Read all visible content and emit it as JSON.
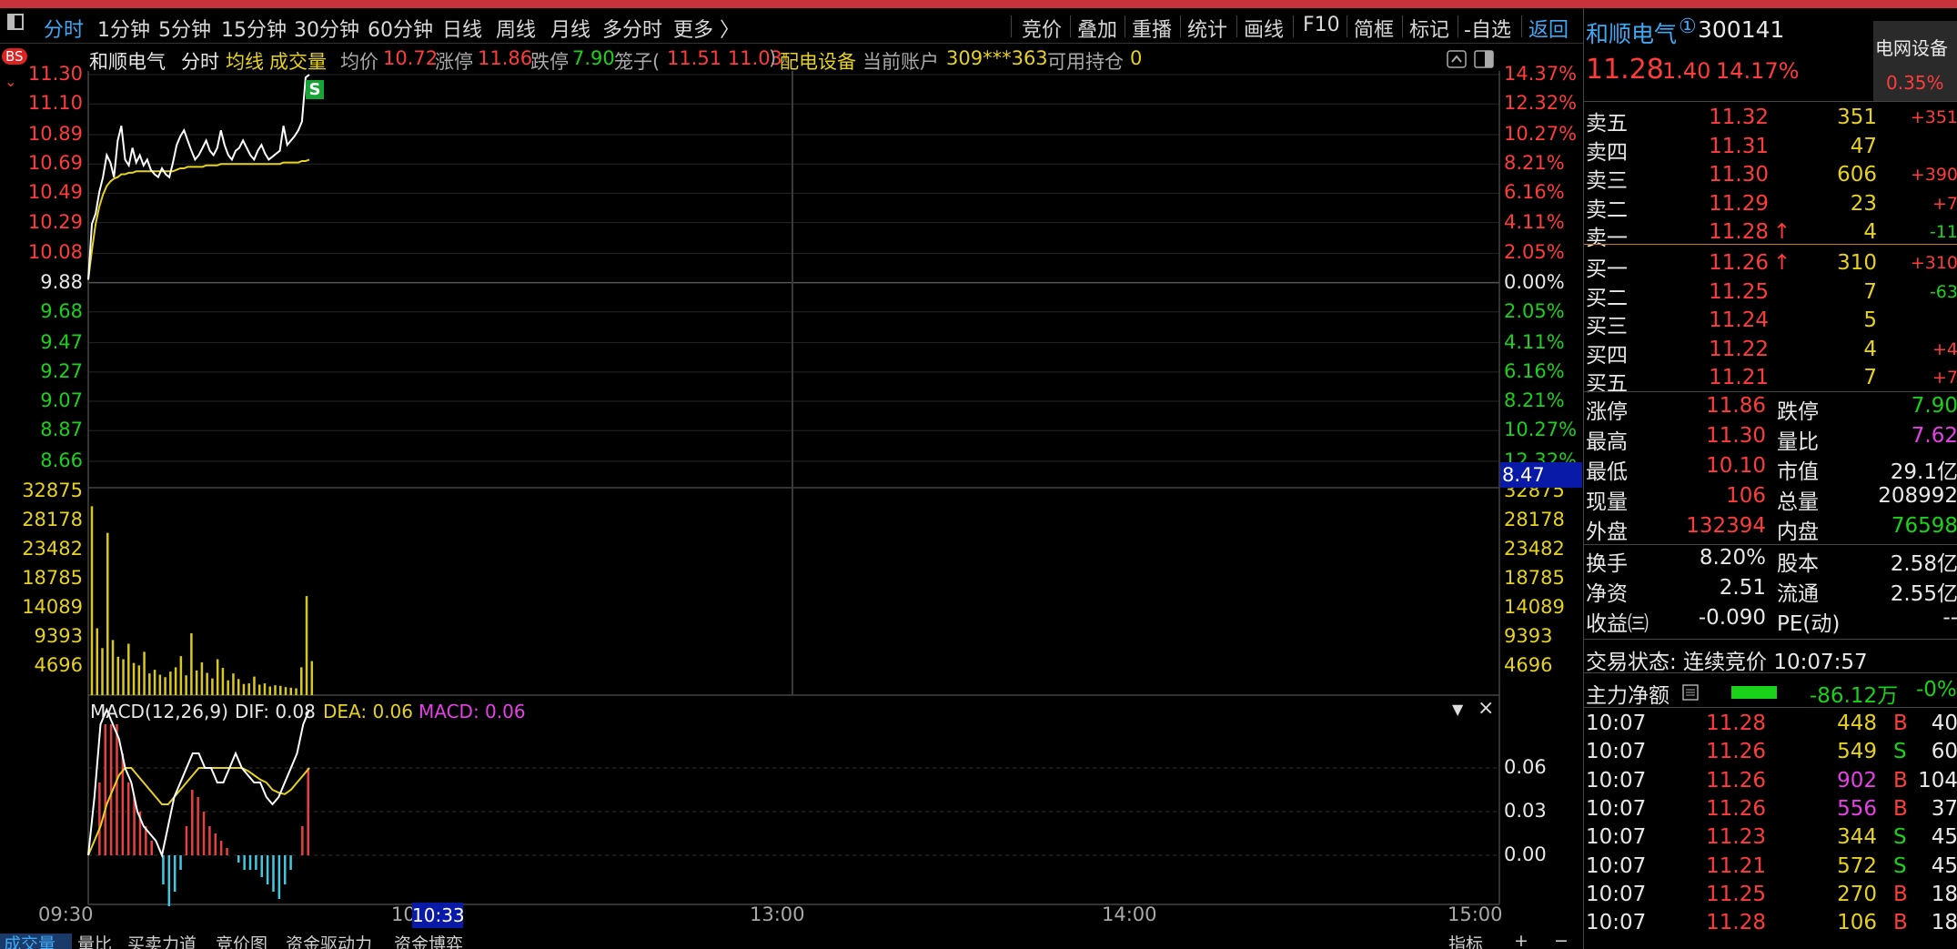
{
  "toolbar": {
    "left_tabs": [
      "分时",
      "1分钟",
      "5分钟",
      "15分钟",
      "30分钟",
      "60分钟",
      "日线",
      "周线",
      "月线",
      "多分时",
      "更多 〉"
    ],
    "right_tools": [
      "竞价",
      "叠加",
      "重播",
      "统计",
      "画线",
      "F10",
      "简框",
      "标记",
      "-自选",
      "返回"
    ]
  },
  "info_bar": {
    "bs_badge": "BS",
    "stock_name": "和顺电气",
    "view": "分时",
    "avg_line_label": "均线",
    "volume_label": "成交量",
    "avg_price_label": "均价",
    "avg_price": "10.72",
    "limit_up_label": "涨停",
    "limit_up": "11.86",
    "limit_down_label": "跌停",
    "limit_down": "7.90",
    "cage_label": "笼子(",
    "cage_values": "11.51 11.03",
    "cage_close": ")",
    "sector": "配电设备",
    "account_label": "当前账户",
    "account": "309***363",
    "position_label": "可用持仓",
    "position": "0"
  },
  "chart": {
    "price_axis_left": [
      "11.30",
      "11.10",
      "10.89",
      "10.69",
      "10.49",
      "10.29",
      "10.08",
      "9.88",
      "9.68",
      "9.47",
      "9.27",
      "9.07",
      "8.87",
      "8.66"
    ],
    "pct_axis_right": [
      "14.37%",
      "12.32%",
      "10.27%",
      "8.21%",
      "6.16%",
      "4.11%",
      "2.05%",
      "0.00%",
      "2.05%",
      "4.11%",
      "6.16%",
      "8.21%",
      "10.27%",
      "12.32%"
    ],
    "cursor_price": "8.47",
    "signal_marker": "S",
    "volume_axis": [
      "32875",
      "28178",
      "23482",
      "18785",
      "14089",
      "9393",
      "4696"
    ],
    "macd_title": "MACD(12,26,9)",
    "macd_dif": "DIF: 0.08",
    "macd_dea": "DEA: 0.06",
    "macd_macd": "MACD: 0.06",
    "macd_axis": [
      "0.06",
      "0.03",
      "0.00"
    ],
    "time_labels": [
      "09:30",
      "10",
      "13:00",
      "14:00",
      "15:00"
    ],
    "cursor_time": "10:33",
    "colors": {
      "price": "#ffffff",
      "avg": "#e6d21e",
      "up": "#ff3b3b",
      "down": "#19d219",
      "volume": "#d8c81c",
      "macd_pos": "#e84040",
      "macd_neg": "#40c8e0"
    }
  },
  "chart_data": {
    "type": "line",
    "price": [
      9.9,
      10.28,
      10.35,
      10.5,
      10.6,
      10.75,
      10.7,
      10.6,
      10.85,
      10.95,
      10.72,
      10.68,
      10.8,
      10.7,
      10.75,
      10.68,
      10.72,
      10.65,
      10.62,
      10.6,
      10.66,
      10.62,
      10.6,
      10.7,
      10.82,
      10.88,
      10.92,
      10.85,
      10.78,
      10.72,
      10.75,
      10.8,
      10.85,
      10.78,
      10.75,
      10.8,
      10.92,
      10.82,
      10.75,
      10.72,
      10.78,
      10.8,
      10.85,
      10.8,
      10.75,
      10.72,
      10.78,
      10.82,
      10.76,
      10.72,
      10.74,
      10.76,
      10.78,
      10.95,
      10.82,
      10.85,
      10.88,
      10.92,
      10.98,
      11.28,
      11.3
    ],
    "avg_price": [
      9.9,
      10.1,
      10.28,
      10.4,
      10.48,
      10.54,
      10.57,
      10.59,
      10.6,
      10.62,
      10.62,
      10.63,
      10.63,
      10.64,
      10.64,
      10.64,
      10.64,
      10.64,
      10.64,
      10.64,
      10.64,
      10.64,
      10.64,
      10.64,
      10.65,
      10.66,
      10.66,
      10.67,
      10.67,
      10.67,
      10.67,
      10.67,
      10.68,
      10.68,
      10.68,
      10.68,
      10.69,
      10.69,
      10.69,
      10.69,
      10.69,
      10.69,
      10.69,
      10.69,
      10.69,
      10.69,
      10.69,
      10.69,
      10.69,
      10.69,
      10.69,
      10.69,
      10.69,
      10.7,
      10.7,
      10.7,
      10.7,
      10.7,
      10.71,
      10.71,
      10.72
    ],
    "volume": [
      30500,
      10800,
      7600,
      26200,
      8900,
      6200,
      5800,
      8300,
      5200,
      4800,
      7000,
      3500,
      4100,
      3300,
      2900,
      3800,
      4500,
      6300,
      3200,
      10000,
      4000,
      5300,
      3600,
      2700,
      5800,
      4400,
      2400,
      3500,
      2600,
      1800,
      1900,
      3000,
      1700,
      1900,
      1400,
      1600,
      1500,
      1300,
      1200,
      1100,
      4500,
      16000,
      5500
    ],
    "macd_hist": [
      0,
      0.05,
      0.09,
      0.09,
      0.09,
      0.07,
      0.05,
      0.04,
      0.03,
      0.02,
      0.01,
      0,
      -0.02,
      -0.035,
      -0.025,
      -0.01,
      0.02,
      0.045,
      0.04,
      0.03,
      0.02,
      0.015,
      0.01,
      0.005,
      0,
      -0.005,
      -0.01,
      -0.01,
      -0.01,
      -0.015,
      -0.02,
      -0.025,
      -0.03,
      -0.02,
      -0.01,
      0,
      0.02,
      0.06
    ],
    "macd_dif": [
      0,
      0.04,
      0.09,
      0.1,
      0.09,
      0.08,
      0.06,
      0.05,
      0.03,
      0.02,
      0.015,
      0.01,
      0,
      0.02,
      0.04,
      0.05,
      0.06,
      0.07,
      0.07,
      0.06,
      0.06,
      0.05,
      0.05,
      0.06,
      0.07,
      0.06,
      0.055,
      0.05,
      0.05,
      0.04,
      0.035,
      0.04,
      0.05,
      0.06,
      0.07,
      0.09,
      0.1
    ],
    "macd_dea": [
      0,
      0.01,
      0.02,
      0.035,
      0.045,
      0.055,
      0.06,
      0.06,
      0.055,
      0.05,
      0.045,
      0.04,
      0.035,
      0.035,
      0.04,
      0.045,
      0.05,
      0.055,
      0.06,
      0.06,
      0.06,
      0.06,
      0.06,
      0.06,
      0.06,
      0.06,
      0.058,
      0.055,
      0.052,
      0.05,
      0.045,
      0.043,
      0.042,
      0.045,
      0.05,
      0.055,
      0.06
    ]
  },
  "quote": {
    "name": "和顺电气",
    "badge": "①",
    "code": "300141",
    "sector_tag": "电网设备",
    "sector_pct": "0.35%",
    "price": "11.28",
    "change": "1.40",
    "change_pct": "14.17%",
    "asks": [
      {
        "label": "卖五",
        "price": "11.32",
        "vol": "351",
        "delta": "+351",
        "arrow": ""
      },
      {
        "label": "卖四",
        "price": "11.31",
        "vol": "47",
        "delta": "",
        "arrow": ""
      },
      {
        "label": "卖三",
        "price": "11.30",
        "vol": "606",
        "delta": "+390",
        "arrow": ""
      },
      {
        "label": "卖二",
        "price": "11.29",
        "vol": "23",
        "delta": "+7",
        "arrow": ""
      },
      {
        "label": "卖一",
        "price": "11.28",
        "vol": "4",
        "delta": "-11",
        "arrow": "↑"
      }
    ],
    "bids": [
      {
        "label": "买一",
        "price": "11.26",
        "vol": "310",
        "delta": "+310",
        "arrow": "↑"
      },
      {
        "label": "买二",
        "price": "11.25",
        "vol": "7",
        "delta": "-63",
        "arrow": ""
      },
      {
        "label": "买三",
        "price": "11.24",
        "vol": "5",
        "delta": "",
        "arrow": ""
      },
      {
        "label": "买四",
        "price": "11.22",
        "vol": "4",
        "delta": "+4",
        "arrow": ""
      },
      {
        "label": "买五",
        "price": "11.21",
        "vol": "7",
        "delta": "+7",
        "arrow": ""
      }
    ],
    "stats1": [
      {
        "k1": "涨停",
        "v1": "11.86",
        "k2": "跌停",
        "v2": "7.90"
      },
      {
        "k1": "最高",
        "v1": "11.30",
        "k2": "量比",
        "v2": "7.62"
      },
      {
        "k1": "最低",
        "v1": "10.10",
        "k2": "市值",
        "v2": "29.1亿"
      },
      {
        "k1": "现量",
        "v1": "106",
        "k2": "总量",
        "v2": "208992"
      },
      {
        "k1": "外盘",
        "v1": "132394",
        "k2": "内盘",
        "v2": "76598"
      }
    ],
    "stats2": [
      {
        "k1": "换手",
        "v1": "8.20%",
        "k2": "股本",
        "v2": "2.58亿"
      },
      {
        "k1": "净资",
        "v1": "2.51",
        "k2": "流通",
        "v2": "2.55亿"
      },
      {
        "k1": "收益㈢",
        "v1": "-0.090",
        "k2": "PE(动)",
        "v2": "--"
      }
    ],
    "status": "交易状态: 连续竞价 10:07:57",
    "main_flow_label": "主力净额",
    "main_flow_value": "-86.12万",
    "main_flow_pct": "-0%",
    "ticks": [
      {
        "time": "10:07",
        "price": "11.28",
        "vol": "448",
        "side": "B",
        "count": "40"
      },
      {
        "time": "10:07",
        "price": "11.26",
        "vol": "549",
        "side": "S",
        "count": "60"
      },
      {
        "time": "10:07",
        "price": "11.26",
        "vol": "902",
        "side": "B",
        "count": "104"
      },
      {
        "time": "10:07",
        "price": "11.26",
        "vol": "556",
        "side": "B",
        "count": "37"
      },
      {
        "time": "10:07",
        "price": "11.23",
        "vol": "344",
        "side": "S",
        "count": "45"
      },
      {
        "time": "10:07",
        "price": "11.21",
        "vol": "572",
        "side": "S",
        "count": "45"
      },
      {
        "time": "10:07",
        "price": "11.25",
        "vol": "270",
        "side": "B",
        "count": "18"
      },
      {
        "time": "10:07",
        "price": "11.28",
        "vol": "106",
        "side": "B",
        "count": "18"
      }
    ]
  },
  "bottom_tabs": [
    "成交量",
    "量比",
    "买卖力道",
    "竞价图",
    "资金驱动力",
    "资金博弈"
  ],
  "bottom_right": [
    "指标",
    "+",
    "−"
  ]
}
